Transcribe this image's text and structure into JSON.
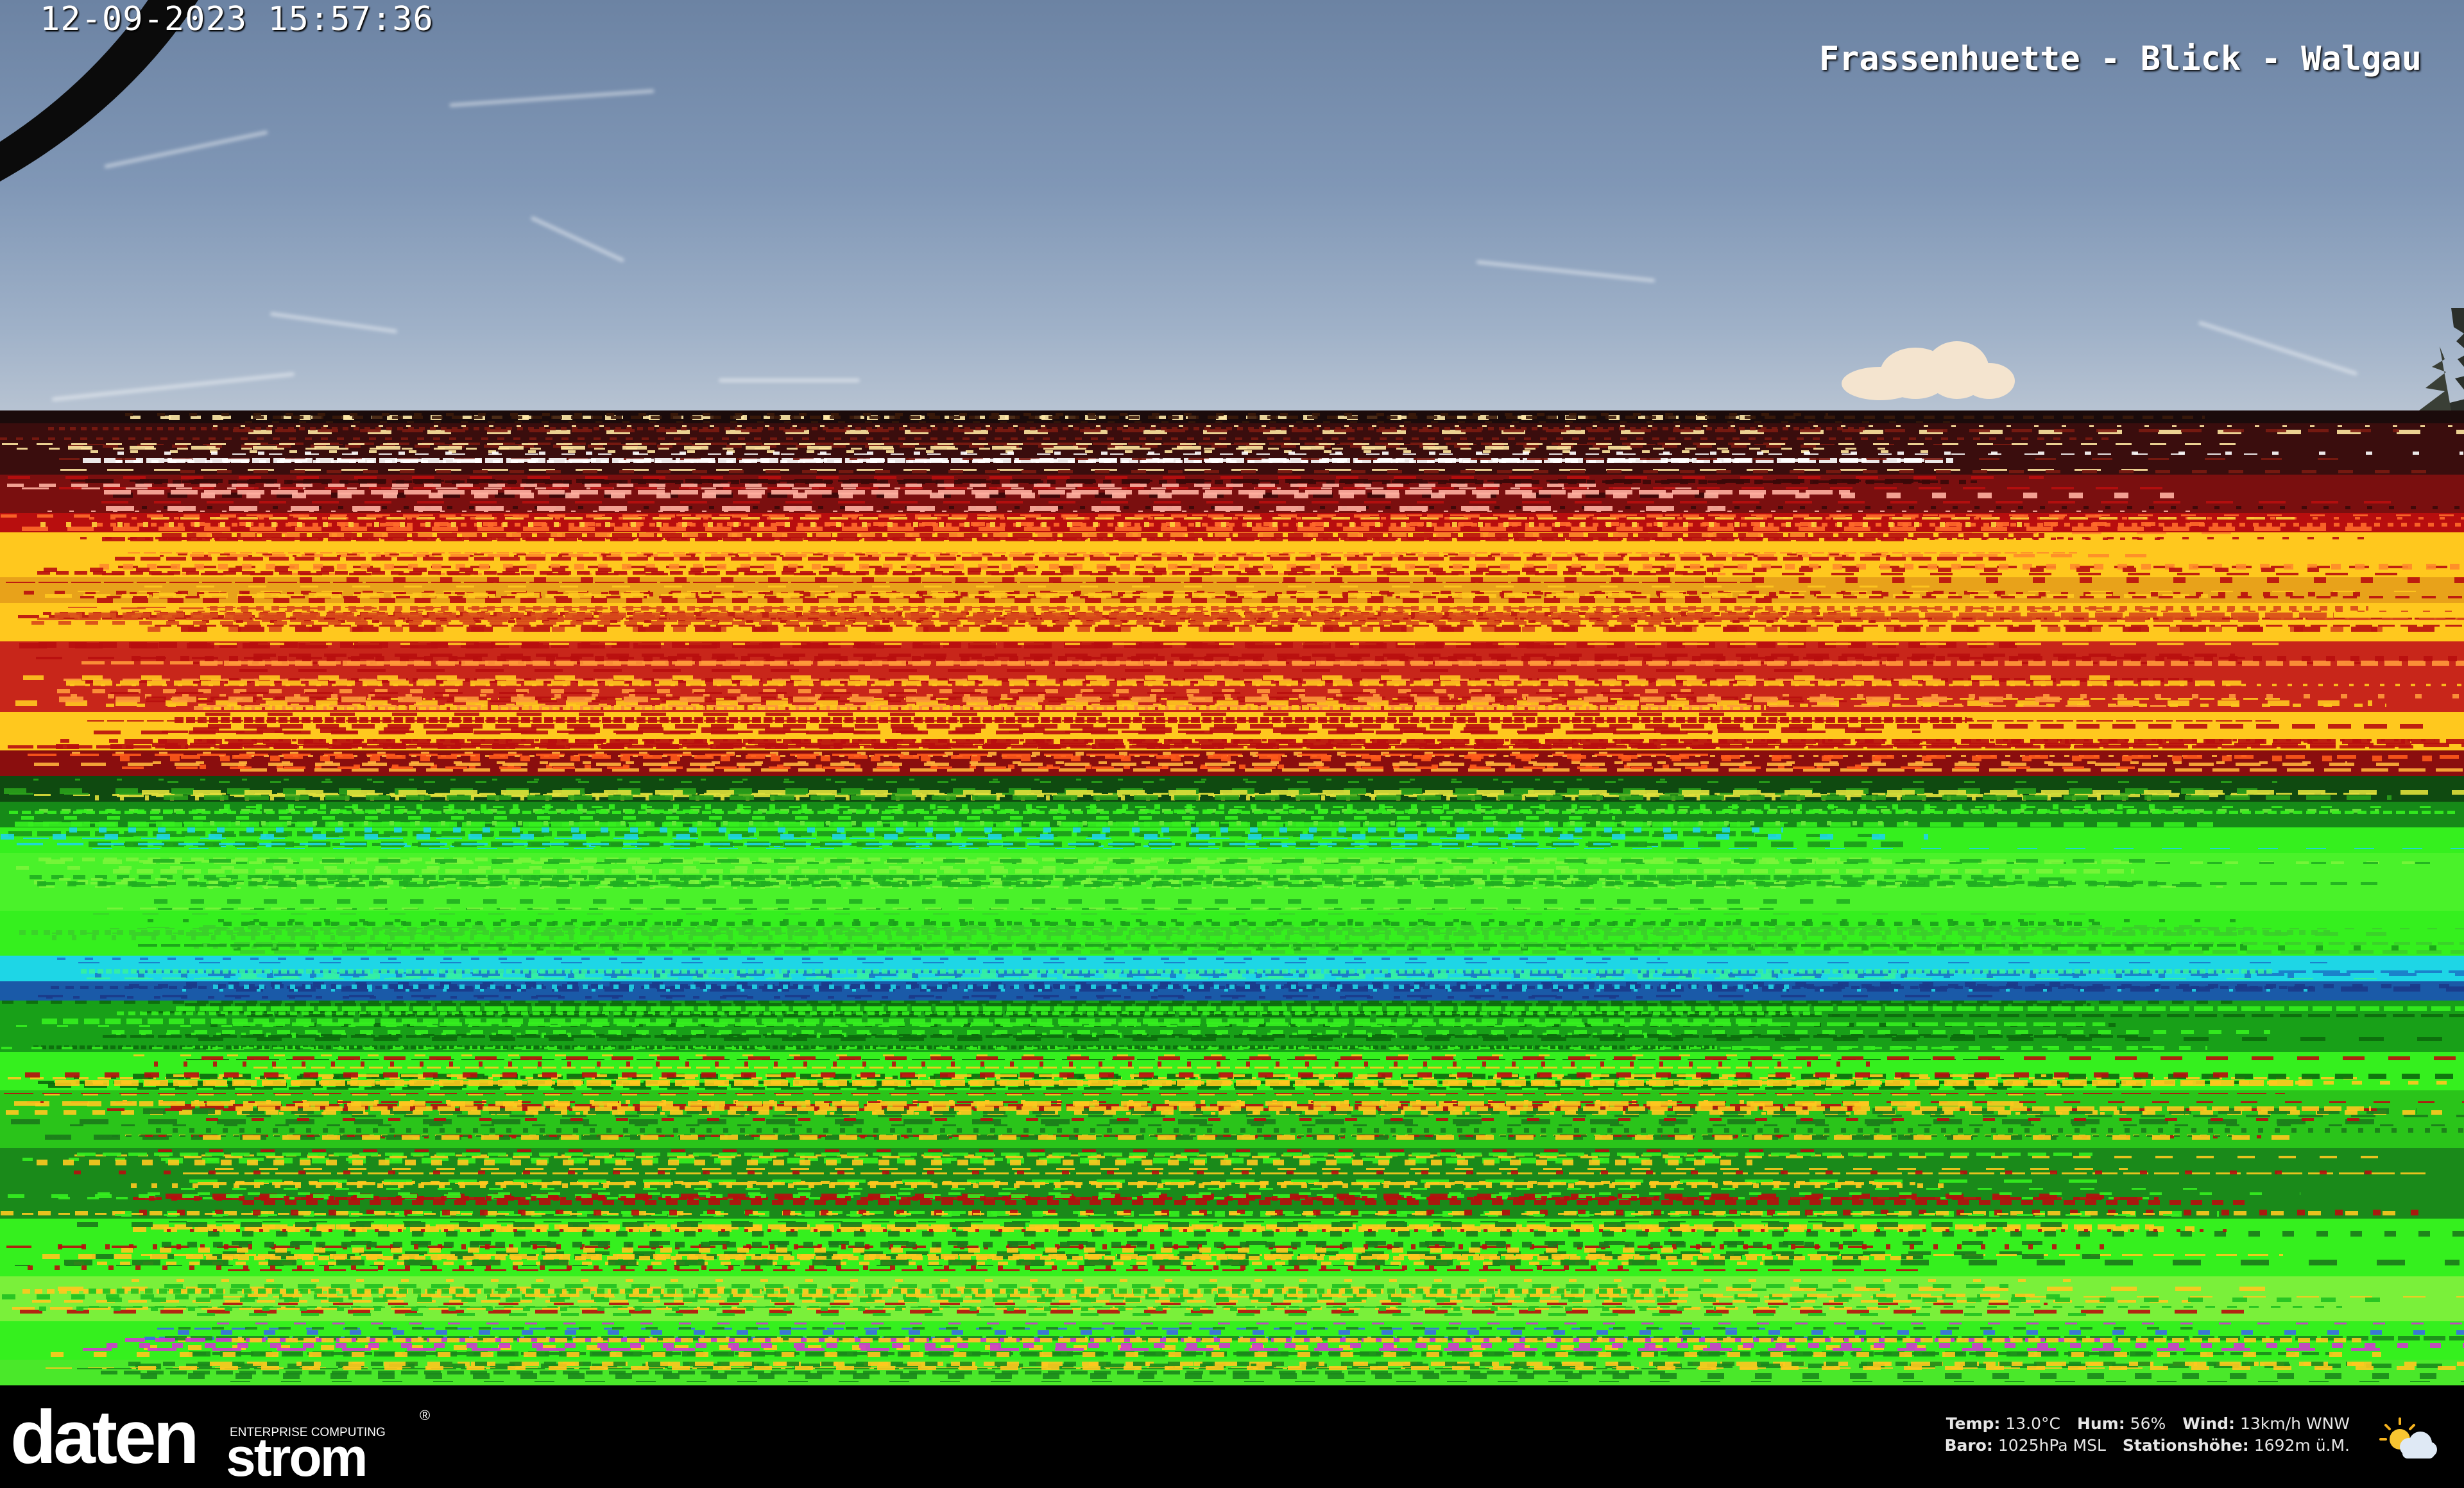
{
  "overlay": {
    "timestamp": "12-09-2023 15:57:36",
    "camera_title": "Frassenhuette - Blick - Walgau"
  },
  "brand": {
    "logo_text_main": "daten",
    "logo_text_strom": "strom",
    "logo_tagline": "ENTERPRISE COMPUTING",
    "logo_registered": "®"
  },
  "weather": {
    "temp_label": "Temp:",
    "temp_value": "13.0°C",
    "hum_label": "Hum:",
    "hum_value": "56%",
    "wind_label": "Wind:",
    "wind_value": "13km/h WNW",
    "baro_label": "Baro:",
    "baro_value": "1025hPa MSL",
    "elevation_label": "Stationshöhe:",
    "elevation_value": "1692m ü.M.",
    "icon": "partly-cloudy-icon"
  },
  "colors": {
    "sky": "#8097b6",
    "band_red": "#b80e0e",
    "band_yellow": "#ffc81e",
    "band_green": "#35f01e",
    "band_cyan": "#1ed6e6"
  }
}
